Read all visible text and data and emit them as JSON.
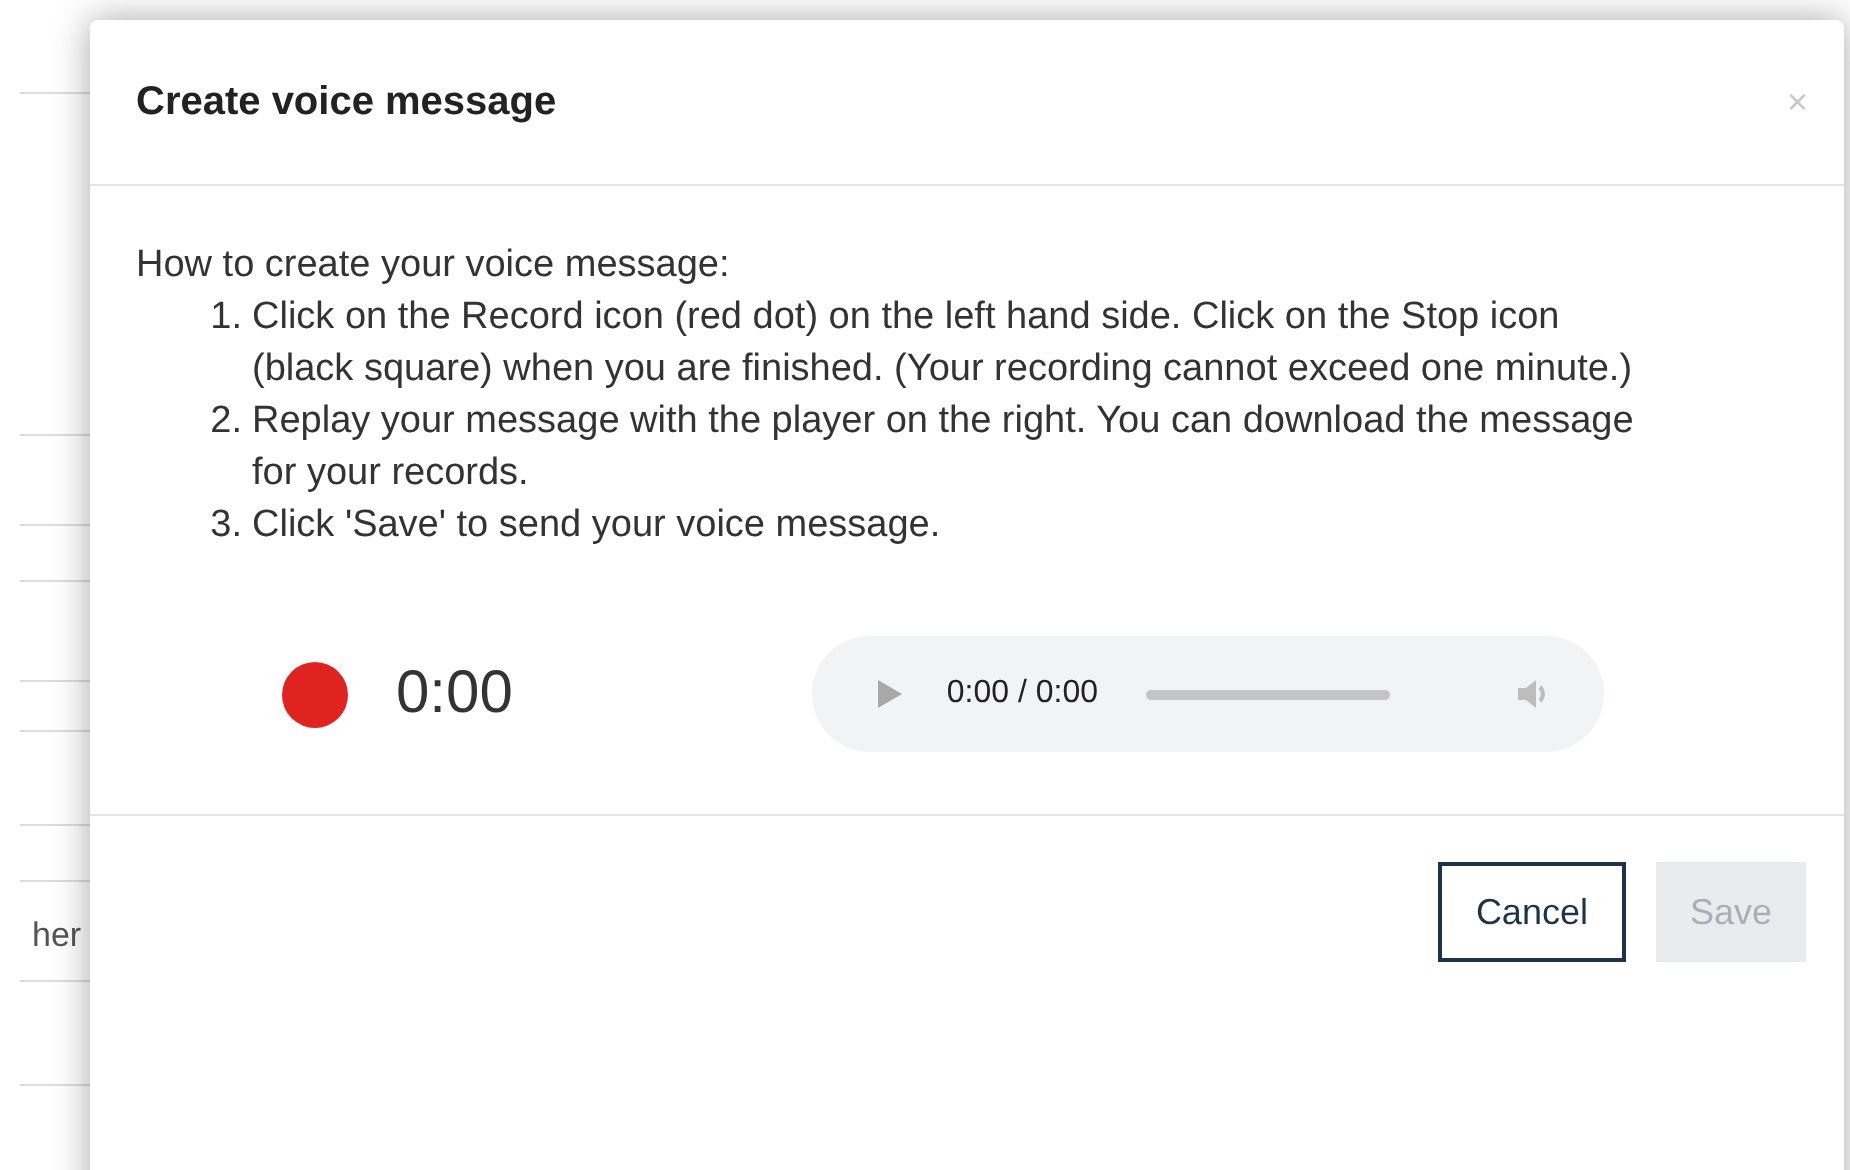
{
  "background": {
    "fragment": "her"
  },
  "dialog": {
    "title": "Create voice message",
    "close": "×",
    "intro": "How to create your voice message:",
    "steps": [
      {
        "number": "1.",
        "text": "Click on the Record icon (red dot) on the left hand side. Click on the Stop icon (black square) when you are finished. (Your recording cannot exceed one minute.)"
      },
      {
        "number": "2.",
        "text": "Replay your message with the player on the right. You can download the message for your records."
      },
      {
        "number": "3.",
        "text": "Click 'Save' to send your voice message."
      }
    ],
    "recorder": {
      "timer": "0:00"
    },
    "player": {
      "time": "0:00 / 0:00"
    },
    "buttons": [
      {
        "label": "Cancel",
        "disabled": false
      },
      {
        "label": "Save",
        "disabled": true
      }
    ]
  }
}
